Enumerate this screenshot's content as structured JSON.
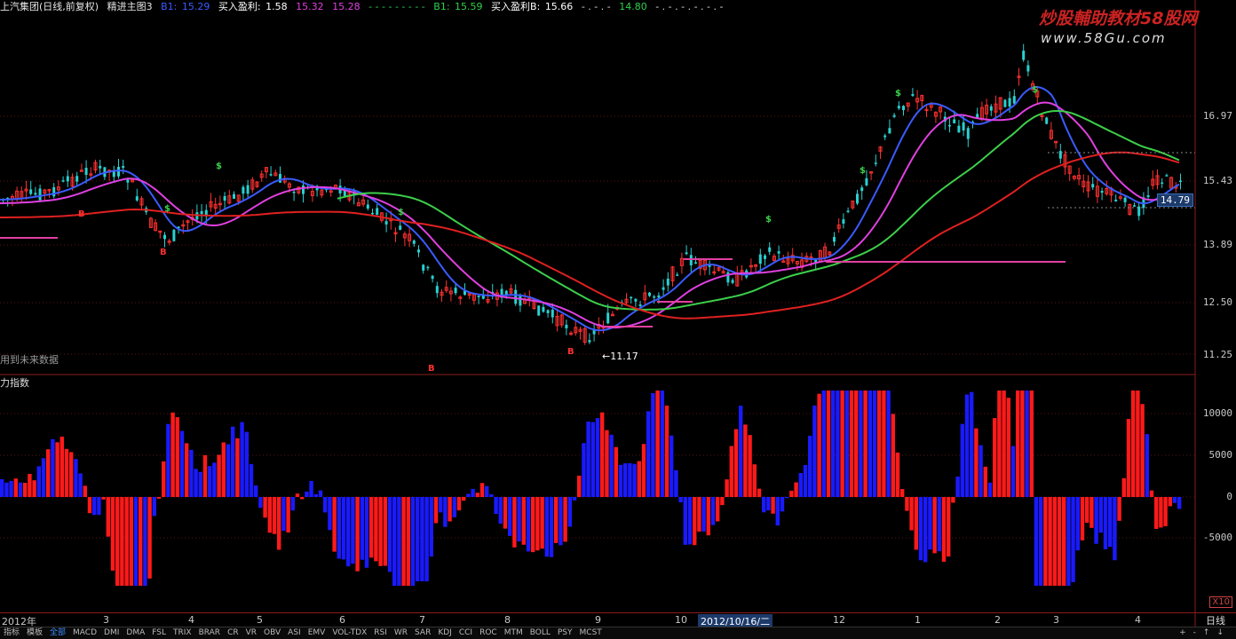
{
  "header": {
    "stock_title": "上汽集团(日线,前复权)",
    "indicator_name": "精进主图3",
    "b1_label": "B1:",
    "b1_value": "15.29",
    "buy_profit_label": "买入盈利:",
    "buy_profit_value": "1.58",
    "v2": "15.32",
    "v3": "15.28",
    "dashes1": "- - - - - - - - -",
    "bb1_label": "B1:",
    "bb1_value": "15.59",
    "buy_profit_b_label": "买入盈利B:",
    "buy_profit_b_value": "15.66",
    "dashes2": "- . - . -",
    "v4": "14.80",
    "dashes3": "- . - . - . - . - . -",
    "colors": {
      "title": "#e6e6e6",
      "blue": "#3b5bff",
      "magenta": "#e040e0",
      "green": "#2fd04a",
      "white": "#ffffff"
    }
  },
  "logo": {
    "text": "炒股輔助教材58股网",
    "url": "www.58Gu.com"
  },
  "price_axis": {
    "labels": [
      "16.97",
      "15.43",
      "13.89",
      "12.50",
      "11.25"
    ],
    "current": "14.79"
  },
  "annotations": {
    "low_price": "11.17",
    "future_data_note": "用到未来数据"
  },
  "lower_panel": {
    "title": "力指数",
    "labels": [
      "10000",
      "5000",
      "0",
      "-5000"
    ],
    "scale": "X10"
  },
  "date_axis": {
    "labels": [
      "2012年",
      "3",
      "4",
      "5",
      "6",
      "7",
      "8",
      "9",
      "10",
      "12",
      "1",
      "2",
      "3",
      "4"
    ],
    "selected": "2012/10/16/二",
    "period": "日线"
  },
  "tabs": {
    "items": [
      "指标",
      "模板",
      "全部",
      "MACD",
      "DMI",
      "DMA",
      "FSL",
      "TRIX",
      "BRAR",
      "CR",
      "VR",
      "OBV",
      "ASI",
      "EMV",
      "VOL-TDX",
      "RSI",
      "WR",
      "SAR",
      "KDJ",
      "CCI",
      "ROC",
      "MTM",
      "BOLL",
      "PSY",
      "MCST"
    ],
    "active": "全部",
    "controls": [
      "+",
      "-",
      "↑",
      "↓"
    ]
  },
  "series": {
    "colors": {
      "up": "#ff3030",
      "down": "#2ad0d0",
      "ma_short": "#3b5bff",
      "ma_mid": "#e040e0",
      "ma_long": "#e02020",
      "ma_green": "#3ccf4a",
      "bar_red": "#ff1a1a",
      "bar_blue": "#1a1aff"
    }
  }
}
